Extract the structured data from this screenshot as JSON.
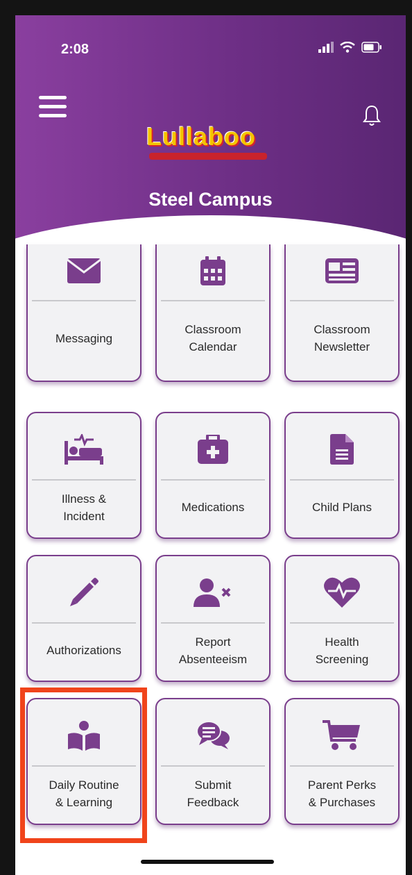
{
  "status_bar": {
    "time": "2:08",
    "icons": [
      "signal-icon",
      "wifi-icon",
      "battery-icon"
    ]
  },
  "header": {
    "menu_icon": "menu-icon",
    "bell_icon": "bell-icon",
    "logo_text": "Lullaboo",
    "campus": "Steel Campus"
  },
  "colors": {
    "brand_purple": "#7a3e8c",
    "header_gradient_start": "#8a3f9f",
    "header_gradient_end": "#5a2673",
    "highlight": "#f0441b"
  },
  "tiles": [
    {
      "label": "Messaging",
      "icon": "envelope-icon"
    },
    {
      "label": "Classroom\nCalendar",
      "icon": "calendar-icon"
    },
    {
      "label": "Classroom\nNewsletter",
      "icon": "newsletter-icon"
    },
    {
      "label": "Illness &\nIncident",
      "icon": "bed-heartbeat-icon"
    },
    {
      "label": "Medications",
      "icon": "medical-kit-icon"
    },
    {
      "label": "Child Plans",
      "icon": "document-icon"
    },
    {
      "label": "Authorizations",
      "icon": "pencil-icon"
    },
    {
      "label": "Report\nAbsenteeism",
      "icon": "user-remove-icon"
    },
    {
      "label": "Health\nScreening",
      "icon": "heartbeat-icon"
    },
    {
      "label": "Daily Routine\n& Learning",
      "icon": "reading-icon"
    },
    {
      "label": "Submit\nFeedback",
      "icon": "chat-icon"
    },
    {
      "label": "Parent Perks\n& Purchases",
      "icon": "cart-icon"
    }
  ]
}
